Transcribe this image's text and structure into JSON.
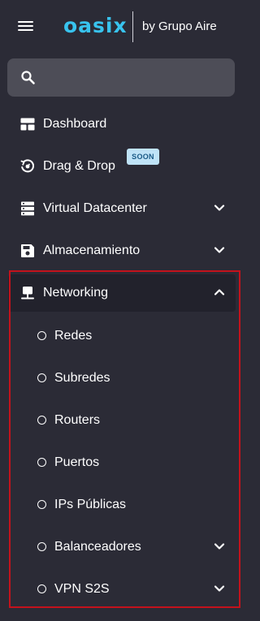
{
  "header": {
    "logo_text": "oasix",
    "logo_subtitle": "by Grupo Aire"
  },
  "search": {
    "placeholder": ""
  },
  "menu": {
    "dashboard": {
      "label": "Dashboard"
    },
    "drag_drop": {
      "label": "Drag & Drop",
      "badge": "SOON"
    },
    "virtual_datacenter": {
      "label": "Virtual Datacenter"
    },
    "almacenamiento": {
      "label": "Almacenamiento"
    },
    "networking": {
      "label": "Networking",
      "expanded": true,
      "children": [
        {
          "label": "Redes"
        },
        {
          "label": "Subredes"
        },
        {
          "label": "Routers"
        },
        {
          "label": "Puertos"
        },
        {
          "label": "IPs Públicas"
        },
        {
          "label": "Balanceadores"
        },
        {
          "label": "VPN S2S"
        }
      ]
    }
  },
  "colors": {
    "background": "#2b2b36",
    "brand": "#38c3ee",
    "active_item": "#22222c",
    "highlight_border": "#c4121c",
    "badge_bg": "#bfe3f7"
  }
}
